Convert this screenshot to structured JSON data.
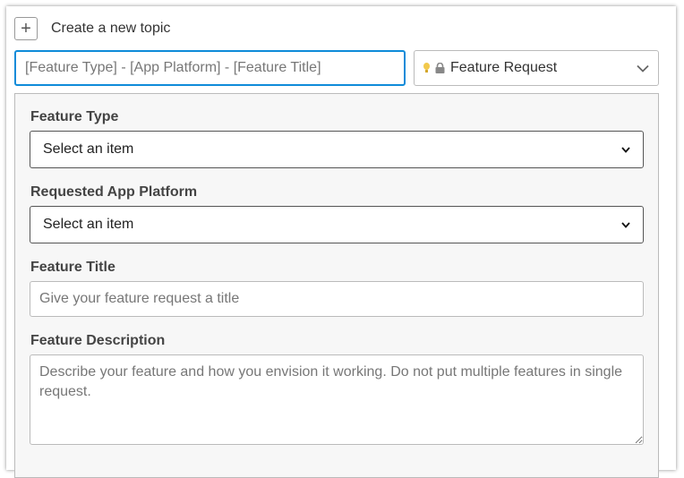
{
  "header": {
    "plus_symbol": "+",
    "title": "Create a new topic"
  },
  "title_field": {
    "placeholder": "[Feature Type] - [App Platform] - [Feature Title]",
    "value": ""
  },
  "category": {
    "label": "Feature Request",
    "bulb_color": "#f2c94c",
    "lock_color": "#888888"
  },
  "form": {
    "feature_type": {
      "label": "Feature Type",
      "selected": "Select an item"
    },
    "app_platform": {
      "label": "Requested App Platform",
      "selected": "Select an item"
    },
    "feature_title": {
      "label": "Feature Title",
      "placeholder": "Give your feature request a title"
    },
    "feature_description": {
      "label": "Feature Description",
      "placeholder": "Describe your feature and how you envision it working. Do not put multiple features in single request."
    }
  },
  "colors": {
    "focus_border": "#0f8bd9",
    "panel_bg": "#f7f7f7"
  }
}
